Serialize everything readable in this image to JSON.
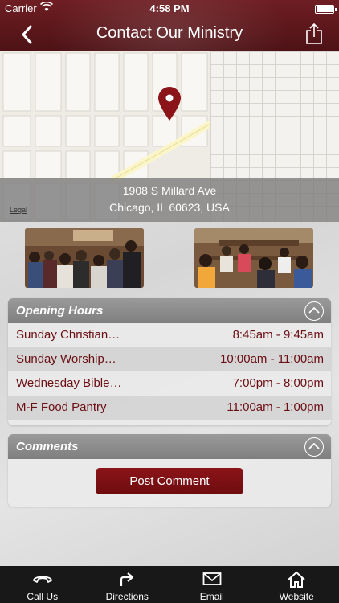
{
  "status": {
    "carrier": "Carrier",
    "time": "4:58 PM"
  },
  "nav": {
    "title": "Contact Our Ministry"
  },
  "map": {
    "address_line1": "1908 S Millard Ave",
    "address_line2": "Chicago, IL 60623, USA",
    "legal": "Legal",
    "pin_color": "#8b1418"
  },
  "hours": {
    "title": "Opening Hours",
    "rows": [
      {
        "name": "Sunday Christian…",
        "time": "8:45am - 9:45am"
      },
      {
        "name": "Sunday Worship…",
        "time": "10:00am - 11:00am"
      },
      {
        "name": "Wednesday Bible…",
        "time": "7:00pm - 8:00pm"
      },
      {
        "name": "M-F Food Pantry",
        "time": "11:00am - 1:00pm"
      }
    ]
  },
  "comments": {
    "title": "Comments",
    "post_label": "Post Comment"
  },
  "tabs": {
    "call": "Call Us",
    "directions": "Directions",
    "email": "Email",
    "website": "Website"
  },
  "colors": {
    "brand": "#6e1e23",
    "accent_text": "#6b0f14",
    "tabbar": "#181818"
  }
}
